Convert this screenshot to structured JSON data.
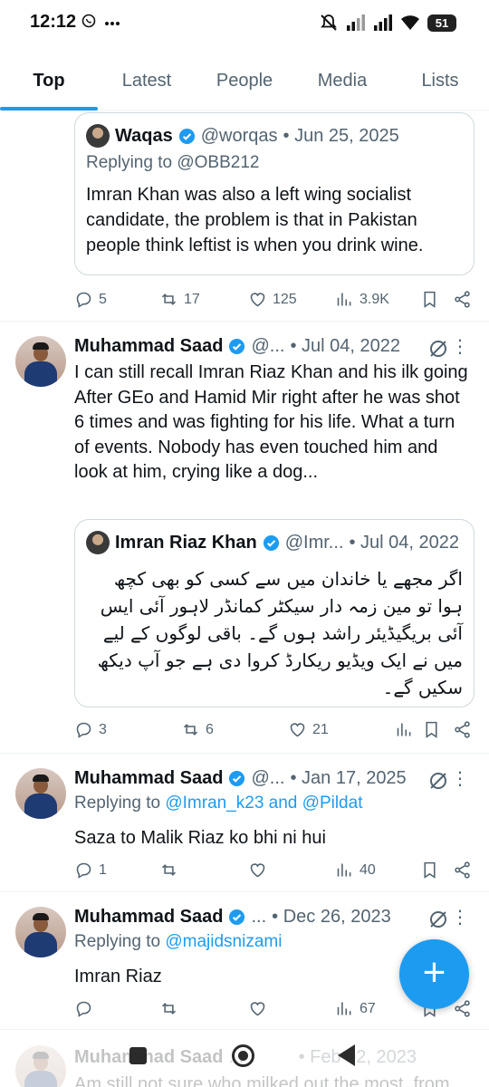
{
  "status_bar": {
    "time": "12:12",
    "left_icons": [
      "whatsapp-icon",
      "more-dots-icon"
    ],
    "right_icons": [
      "mute-icon",
      "signal-icon",
      "signal-icon",
      "wifi-icon"
    ],
    "battery": "51"
  },
  "tabs": [
    {
      "label": "Top",
      "active": true
    },
    {
      "label": "Latest",
      "active": false
    },
    {
      "label": "People",
      "active": false
    },
    {
      "label": "Media",
      "active": false
    },
    {
      "label": "Lists",
      "active": false
    }
  ],
  "quote1": {
    "name": "Waqas",
    "handle": "@worqas",
    "date": "• Jun 25, 2025",
    "replying": "Replying to @OBB212",
    "text": "Imran Khan was also a left wing socialist candidate, the problem is that in Pakistan people think leftist is when you drink wine."
  },
  "quote1_actions": {
    "replies": "5",
    "reposts": "17",
    "likes": "125",
    "views": "3.9K"
  },
  "tweet1": {
    "name": "Muhammad Saad",
    "handle": "@...",
    "date": "• Jul 04, 2022",
    "text": "I can still recall Imran Riaz Khan and his ilk going After GEo and Hamid Mir right after he was shot 6 times and was fighting for his life. What a turn of events. Nobody has even touched him and look at him, crying like a dog...",
    "quote": {
      "name": "Imran Riaz Khan",
      "handle": "@Imr...",
      "date": "• Jul 04, 2022",
      "text": "اگر مجھے یا خاندان میں سے کسی کو بھی کچھ ہوا تو مین زمہ دار سیکٹر کمانڈر لاہور آئی ایس آئی بریگیڈیئر راشد ہوں گے۔ باقی لوگوں کے لیے میں نے ایک ویڈیو ریکارڈ کروا دی ہے جو آپ دیکھ سکیں گے۔"
    },
    "actions": {
      "replies": "3",
      "reposts": "6",
      "likes": "21",
      "views": ""
    }
  },
  "tweet2": {
    "name": "Muhammad Saad",
    "handle": "@...",
    "date": "• Jan 17, 2025",
    "replying_prefix": "Replying to ",
    "replying_links": "@Imran_k23 and @Pildat",
    "text": "Saza to Malik Riaz ko bhi ni hui",
    "actions": {
      "replies": "1",
      "reposts": "",
      "likes": "",
      "views": "40"
    }
  },
  "tweet3": {
    "name": "Muhammad Saad",
    "handle": "...",
    "date": "• Dec 26, 2023",
    "replying_prefix": "Replying to ",
    "replying_links": "@majidsnizami",
    "text": "Imran Riaz",
    "actions": {
      "replies": "",
      "reposts": "",
      "likes": "",
      "views": "67"
    }
  },
  "tweet4": {
    "name": "Muhammad Saad",
    "handle": "...",
    "date": "• Feb 02, 2023",
    "text": "Am still not sure who milked out the most, from"
  },
  "colors": {
    "accent": "#1d9bf0",
    "muted": "#536471",
    "border": "#cfd9de"
  }
}
